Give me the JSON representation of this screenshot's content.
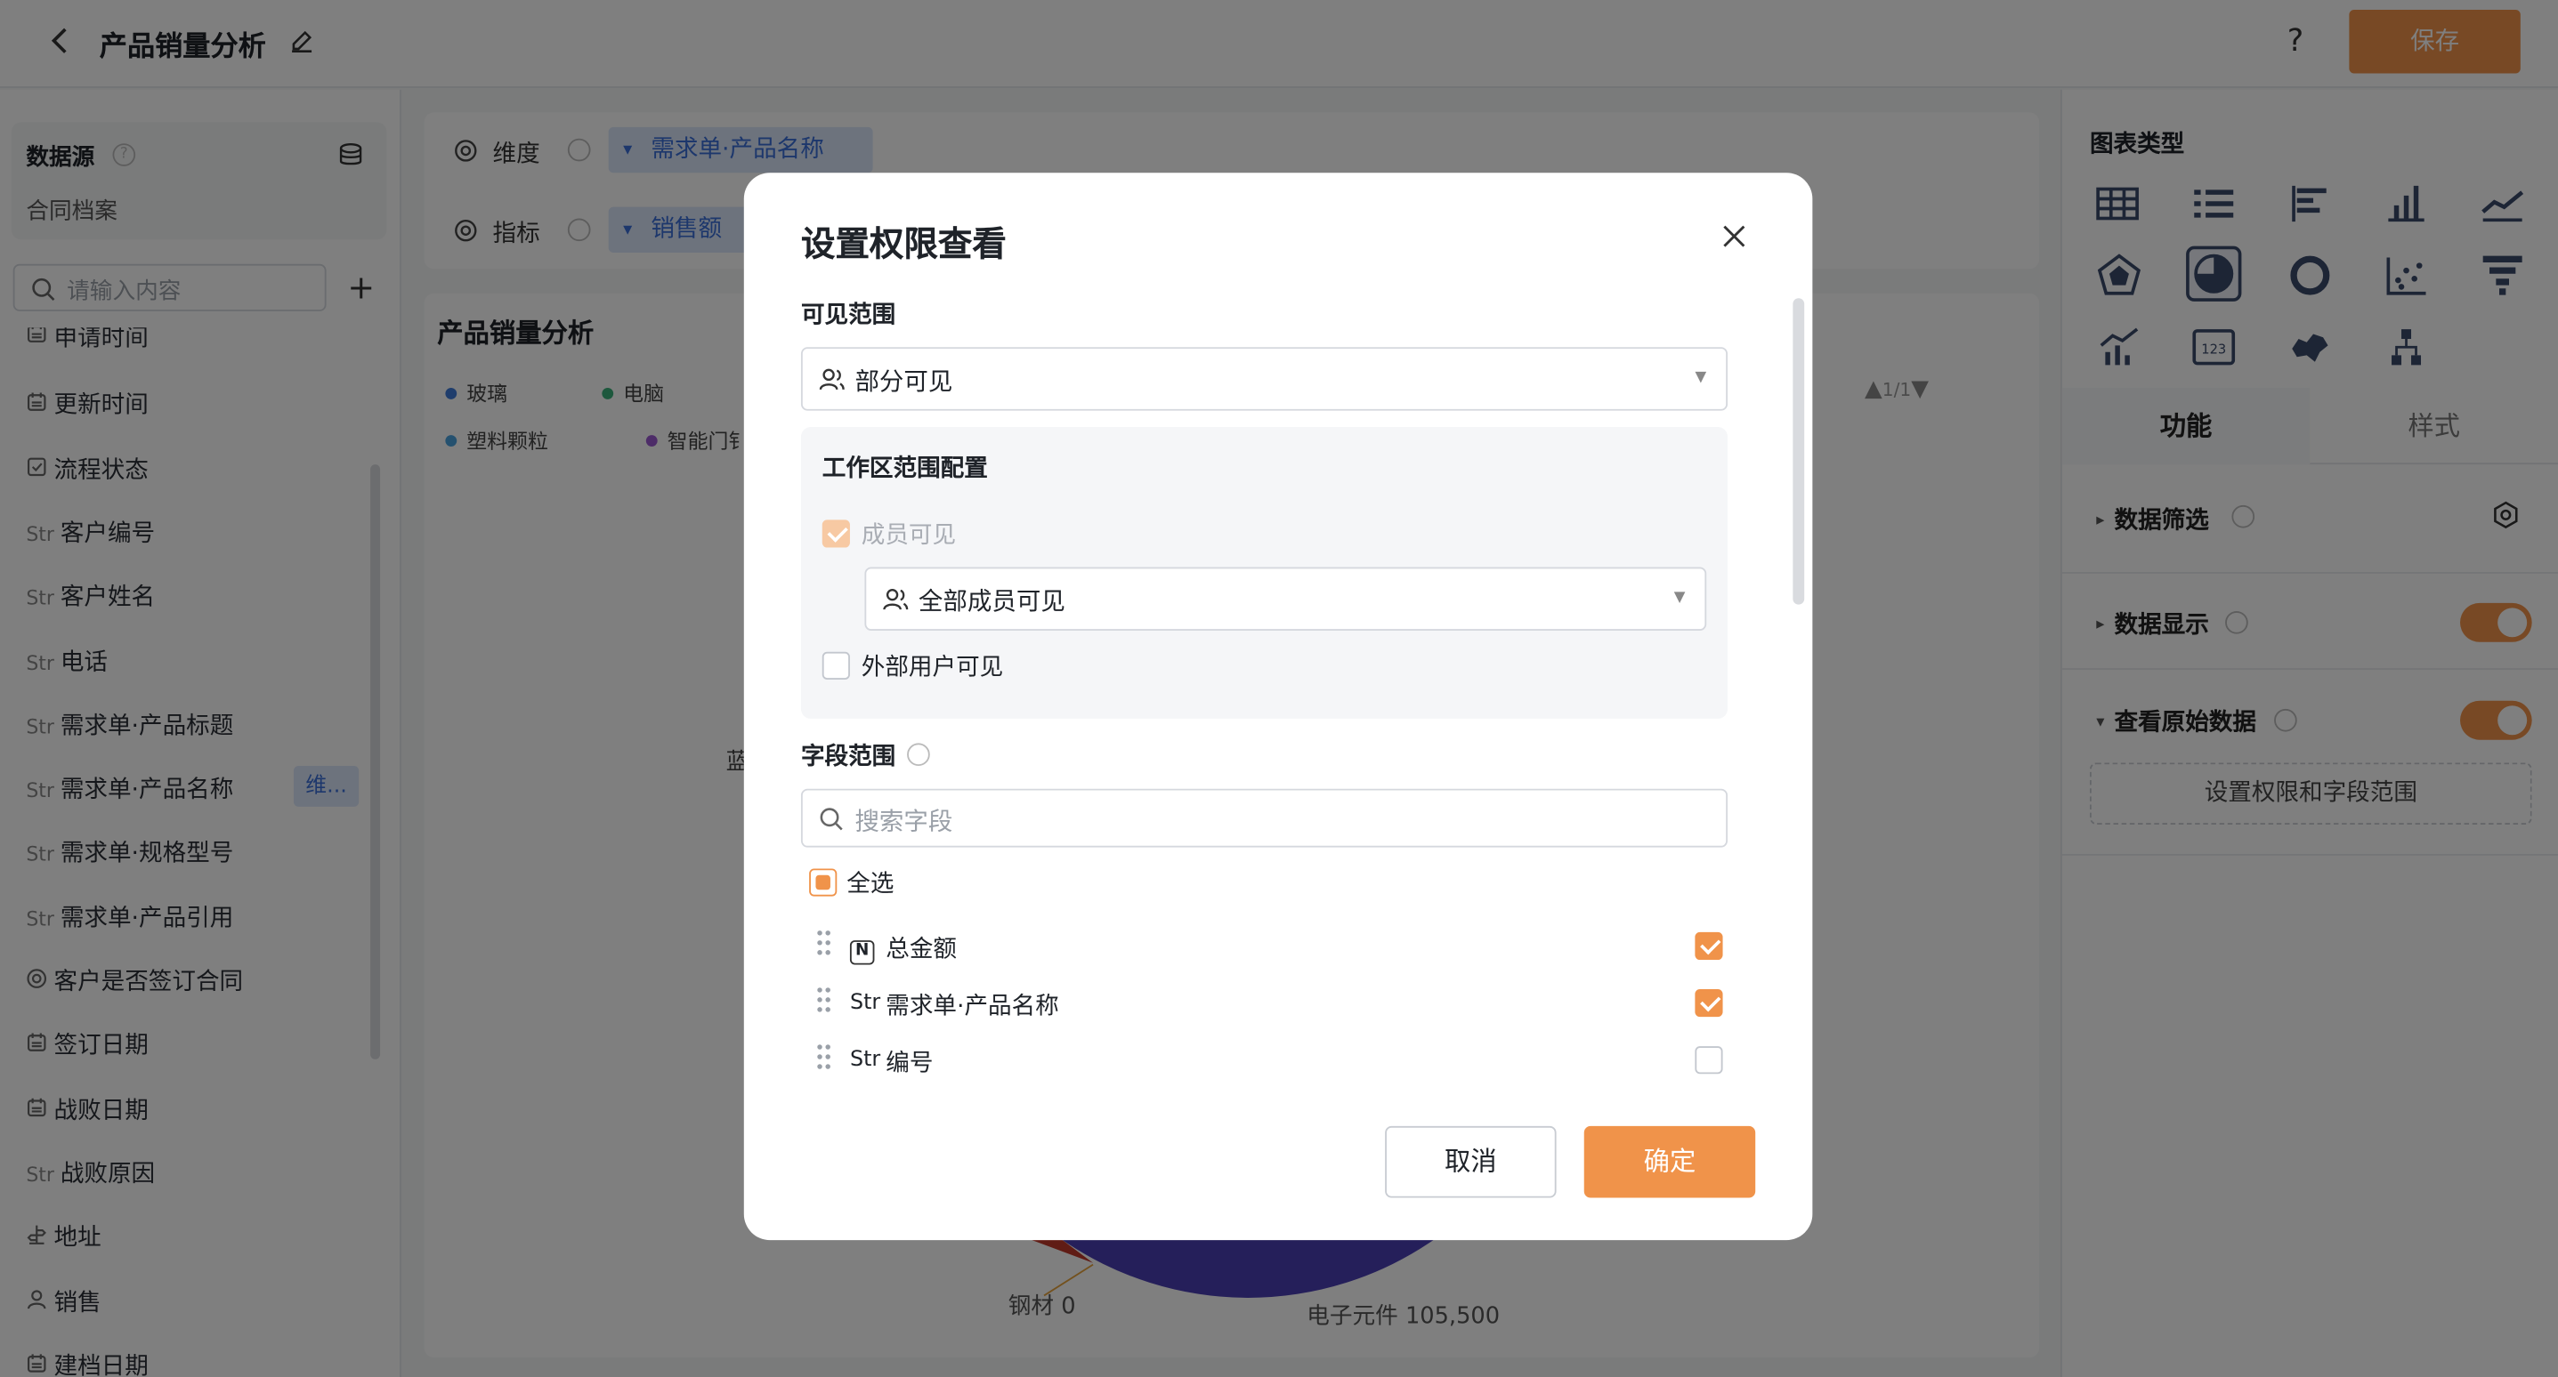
{
  "header": {
    "title": "产品销量分析",
    "help_label": "?",
    "save_label": "保存"
  },
  "datasource": {
    "title": "数据源",
    "name": "合同档案",
    "search_placeholder": "请输入内容",
    "add_label": "+"
  },
  "fields": [
    {
      "type": "date",
      "type_label": "",
      "label": "申请时间"
    },
    {
      "type": "date",
      "type_label": "",
      "label": "更新时间"
    },
    {
      "type": "check",
      "type_label": "",
      "label": "流程状态"
    },
    {
      "type": "str",
      "type_label": "Str",
      "label": "客户编号"
    },
    {
      "type": "str",
      "type_label": "Str",
      "label": "客户姓名"
    },
    {
      "type": "str",
      "type_label": "Str",
      "label": "电话"
    },
    {
      "type": "str",
      "type_label": "Str",
      "label": "需求单·产品标题"
    },
    {
      "type": "str",
      "type_label": "Str",
      "label": "需求单·产品名称"
    },
    {
      "type": "str",
      "type_label": "Str",
      "label": "需求单·规格型号"
    },
    {
      "type": "str",
      "type_label": "Str",
      "label": "需求单·产品引用"
    },
    {
      "type": "radio",
      "type_label": "",
      "label": "客户是否签订合同"
    },
    {
      "type": "date",
      "type_label": "",
      "label": "签订日期"
    },
    {
      "type": "date",
      "type_label": "",
      "label": "战败日期"
    },
    {
      "type": "str",
      "type_label": "Str",
      "label": "战败原因"
    },
    {
      "type": "geo",
      "type_label": "",
      "label": "地址"
    },
    {
      "type": "user",
      "type_label": "",
      "label": "销售"
    },
    {
      "type": "date",
      "type_label": "",
      "label": "建档日期"
    }
  ],
  "dim_tag": "维...",
  "config": {
    "dimension_label": "维度",
    "dimension_value": "需求单·产品名称",
    "metric_label": "指标",
    "metric_value": "销售额"
  },
  "chart": {
    "title": "产品销量分析",
    "legend": [
      {
        "name": "玻璃",
        "color": "#3e7bd8"
      },
      {
        "name": "电脑",
        "color": "#3bb07a"
      },
      {
        "name": "塑料颗粒",
        "color": "#4aa3df"
      },
      {
        "name": "智能门锁",
        "color": "#9b59d0"
      }
    ],
    "legend_visible": [
      "玻璃",
      "电脑",
      "塑料颗粒",
      "智能门钅"
    ],
    "pager": "1/1",
    "labels": {
      "steel": "钢材 0",
      "electronics": "电子元件 105,500",
      "blue_partial": "蓝"
    }
  },
  "chart_data": {
    "type": "pie",
    "categories": [
      "钢材",
      "电子元件"
    ],
    "values": [
      0,
      105500
    ]
  },
  "right_panel": {
    "chart_type_title": "图表类型",
    "tab_function": "功能",
    "tab_style": "样式",
    "data_filter": "数据筛选",
    "data_display": "数据显示",
    "view_raw": "查看原始数据",
    "perm_button": "设置权限和字段范围"
  },
  "modal": {
    "title": "设置权限查看",
    "visible_scope_label": "可见范围",
    "visible_scope_value": "部分可见",
    "workspace_title": "工作区范围配置",
    "member_visible": "成员可见",
    "member_scope_value": "全部成员可见",
    "external_visible": "外部用户可见",
    "field_scope_label": "字段范围",
    "field_search_placeholder": "搜索字段",
    "select_all": "全选",
    "field_rows": [
      {
        "type_label": "N",
        "label": "总金额",
        "checked": true
      },
      {
        "type_label": "Str",
        "label": "需求单·产品名称",
        "checked": true
      },
      {
        "type_label": "Str",
        "label": "编号",
        "checked": false
      }
    ],
    "cancel_label": "取消",
    "ok_label": "确定"
  },
  "colors": {
    "accent": "#f0934a",
    "tag_bg": "#dbe7fb",
    "tag_text": "#3a6fd8"
  }
}
